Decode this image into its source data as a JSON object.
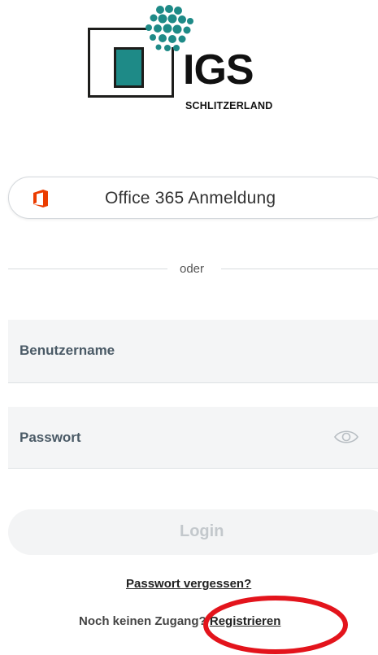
{
  "brand": {
    "name": "IGS",
    "subtitle": "SCHLITZERLAND",
    "teal": "#1e8a87"
  },
  "office_login": {
    "label": "Office 365 Anmeldung",
    "icon": "office-icon",
    "icon_color": "#eb3c00"
  },
  "divider": {
    "label": "oder"
  },
  "form": {
    "username_placeholder": "Benutzername",
    "password_placeholder": "Passwort",
    "password_toggle_icon": "eye-icon",
    "login_label": "Login"
  },
  "links": {
    "forgot_password": "Passwort vergessen?",
    "no_account_text": "Noch keinen Zugang?",
    "register": "Registrieren"
  },
  "annotation": {
    "color": "#e3141c"
  }
}
